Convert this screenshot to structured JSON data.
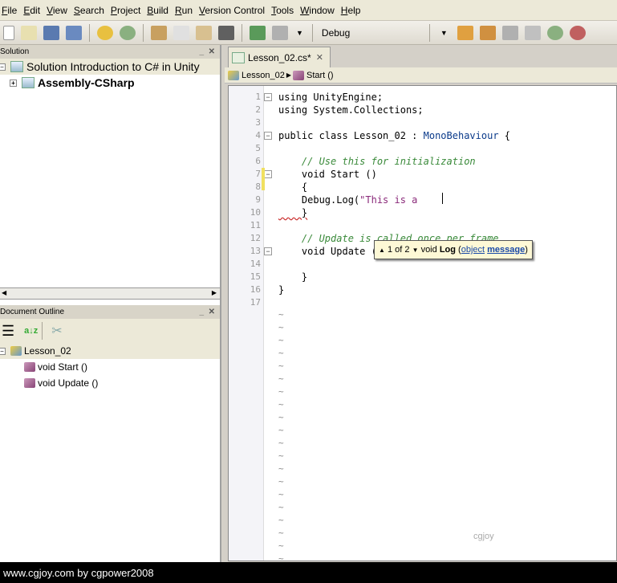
{
  "menu": [
    "File",
    "Edit",
    "View",
    "Search",
    "Project",
    "Build",
    "Run",
    "Version Control",
    "Tools",
    "Window",
    "Help"
  ],
  "toolbar": {
    "config": "Debug"
  },
  "solution": {
    "title": "Solution",
    "root": "Solution Introduction to C# in Unity",
    "project": "Assembly-CSharp"
  },
  "outline": {
    "title": "Document Outline",
    "class": "Lesson_02",
    "members": [
      "void Start ()",
      "void Update ()"
    ]
  },
  "editor": {
    "tab": "Lesson_02.cs*",
    "breadcrumb": {
      "class": "Lesson_02",
      "method": "Start ()"
    },
    "lines": [
      {
        "n": "1",
        "code": "using UnityEngine;"
      },
      {
        "n": "2",
        "code": "using System.Collections;"
      },
      {
        "n": "3",
        "code": ""
      },
      {
        "n": "4",
        "code": "public class Lesson_02 : MonoBehaviour {"
      },
      {
        "n": "5",
        "code": ""
      },
      {
        "n": "6",
        "code": "    // Use this for initialization"
      },
      {
        "n": "7",
        "code": "    void Start ()"
      },
      {
        "n": "8",
        "code": "    {"
      },
      {
        "n": "9",
        "code": "    Debug.Log(\"This is a "
      },
      {
        "n": "10",
        "code": "    }"
      },
      {
        "n": "11",
        "code": ""
      },
      {
        "n": "12",
        "code": "    // Update is called once per frame"
      },
      {
        "n": "13",
        "code": "    void Update () {"
      },
      {
        "n": "14",
        "code": ""
      },
      {
        "n": "15",
        "code": "    }"
      },
      {
        "n": "16",
        "code": "}"
      },
      {
        "n": "17",
        "code": ""
      }
    ],
    "tooltip": {
      "counter": "1 of 2",
      "ret": "void",
      "name": "Log",
      "param_type": "object",
      "param_name": "message"
    }
  },
  "watermark": "www.cgjoy.com",
  "footer": "www.cgjoy.com by cgpower2008"
}
